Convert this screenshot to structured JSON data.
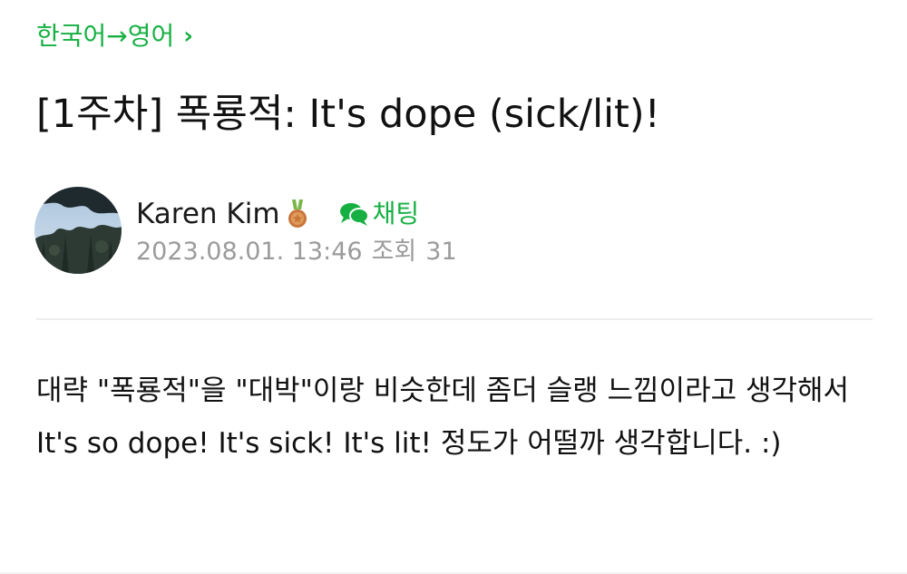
{
  "breadcrumb": {
    "label": "한국어→영어",
    "chevron": "›"
  },
  "post": {
    "title": "[1주차] 폭룡적: It's dope (sick/lit)!",
    "author": {
      "name": "Karen Kim",
      "badge_icon": "medal-icon",
      "chat_label": "채팅",
      "chat_icon": "chat-bubble-icon"
    },
    "meta": {
      "date": "2023.08.01. 13:46",
      "views_label": "조회",
      "views_count": "31"
    },
    "body": "대략 \"폭룡적\"을 \"대박\"이랑 비슷한데 좀더 슬랭 느낌이라고 생각해서 It's so dope! It's sick! It's lit! 정도가 어떨까 생각합니다. :)"
  },
  "colors": {
    "accent_green": "#16b042",
    "meta_gray": "#9b9b9b",
    "divider": "#ececec",
    "text": "#111111"
  }
}
